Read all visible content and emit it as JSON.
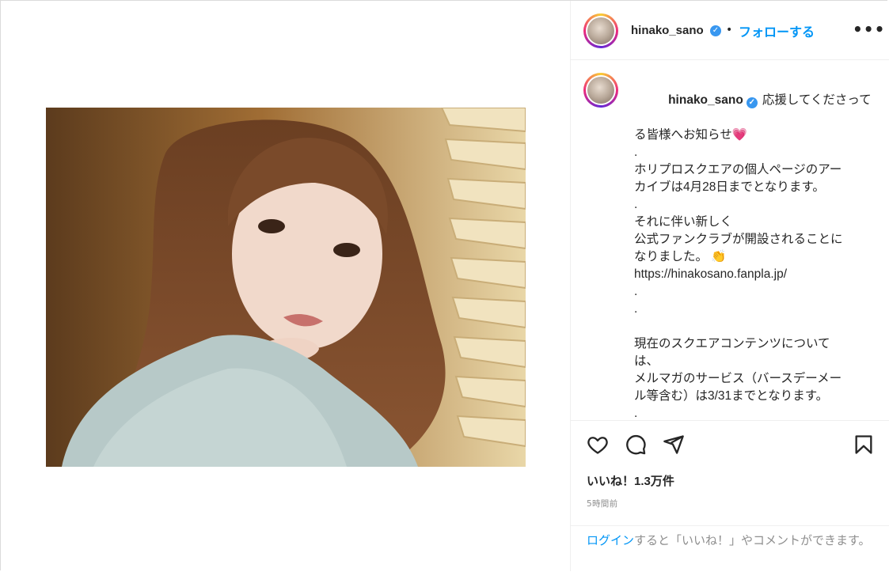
{
  "post": {
    "username": "hinako_sano",
    "follow_label": "フォローする",
    "separator": "•",
    "more_icon": "more-horizontal-icon",
    "verified_icon": "verified-badge-icon"
  },
  "caption": {
    "username": "hinako_sano",
    "first_line_text": "応援してくださって",
    "lines": [
      "る皆様へお知らせ",
      ".",
      "ホリプロスクエアの個人ページのアー",
      "カイブは4月28日までとなります。",
      ".",
      "それに伴い新しく",
      "公式ファンクラブが開設されることに",
      "なりました。",
      "https://hinakosano.fanpla.jp/",
      ".",
      ".",
      "",
      "現在のスクエアコンテンツについて",
      "は、",
      "メルマガのサービス（バースデーメー",
      "ル等含む）は3/31までとなります。",
      ".",
      "."
    ],
    "heart_emoji": "💗",
    "clap_emoji": "👏"
  },
  "actions": {
    "like_icon": "heart-icon",
    "comment_icon": "comment-icon",
    "share_icon": "paper-plane-icon",
    "save_icon": "bookmark-icon"
  },
  "likes_text": "いいね！1.3万件",
  "timestamp": "5時間前",
  "footer": {
    "login_label": "ログイン",
    "rest_text": "すると「いいね！」やコメントができます。"
  },
  "colors": {
    "accent": "#0095f6",
    "verified": "#3897f0",
    "text": "#262626",
    "muted": "#8e8e8e"
  }
}
